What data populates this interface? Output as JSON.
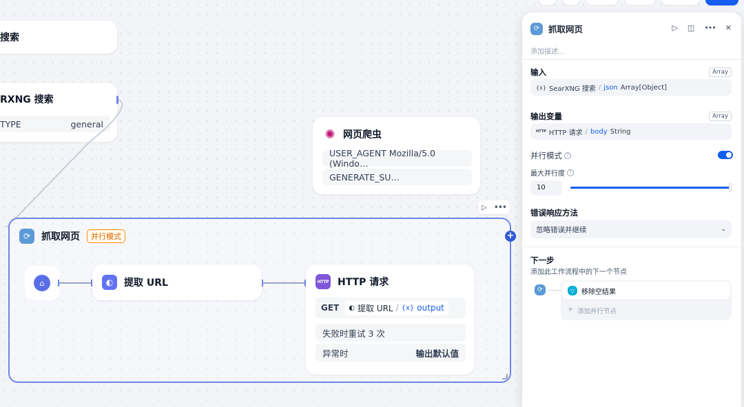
{
  "nodes": {
    "search_top": {
      "title": "搜索"
    },
    "searxng": {
      "title": "RXNG 搜索",
      "row_key": "TYPE",
      "row_value": "general"
    },
    "crawler": {
      "title": "网页爬虫",
      "rows": [
        "USER_AGENT Mozilla/5.0 (Windo…",
        "GENERATE_SU…"
      ]
    }
  },
  "iteration": {
    "title": "抓取网页",
    "badge": "并行模式",
    "extract": {
      "title": "提取 URL"
    },
    "http": {
      "title": "HTTP 请求",
      "icon_text": "HTTP",
      "method": "GET",
      "var_source": "提取 URL",
      "var_sep": "/",
      "var_name": "output",
      "retry": "失败时重试 3 次",
      "error_label": "异常时",
      "error_value": "输出默认值"
    }
  },
  "panel": {
    "title": "抓取网页",
    "description_placeholder": "添加描述...",
    "input_label": "输入",
    "input_type": "Array",
    "input_source": "SearXNG 搜索",
    "input_sep": "/",
    "input_var": "json",
    "input_var_type": "Array[Object]",
    "output_label": "输出变量",
    "output_type": "Array",
    "output_source": "HTTP 请求",
    "output_sep": "/",
    "output_var": "body",
    "output_var_type": "String",
    "parallel_label": "并行模式",
    "parallel_enabled": true,
    "max_parallel_label": "最大并行度",
    "max_parallel_value": "10",
    "max_parallel_fraction": 1.0,
    "error_label": "错误响应方法",
    "error_value": "忽略错误并继续",
    "next_label": "下一步",
    "next_sub": "添加此工作流程中的下一个节点",
    "next_node": "移除空结果",
    "add_parallel": "添加并行节点"
  },
  "colors": {
    "accent": "#155eef",
    "iteration_border": "#6d86e6",
    "badge": "#dc6803"
  }
}
